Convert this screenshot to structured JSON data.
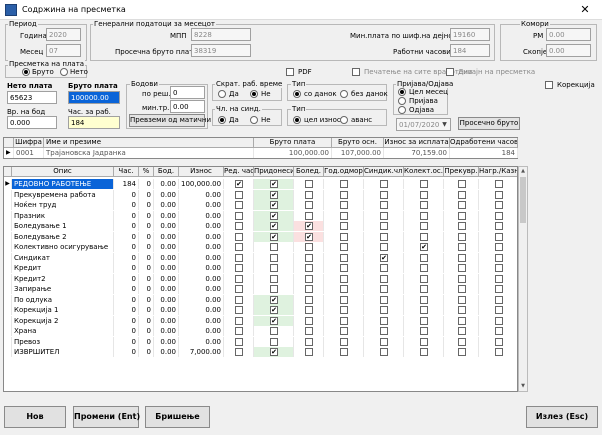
{
  "window": {
    "title": "Содржина на пресметка",
    "close": "✕"
  },
  "period": {
    "title": "Период",
    "year_label": "Година",
    "year": "2020",
    "month_label": "Месец",
    "month": "07"
  },
  "general": {
    "title": "Генерални податоци за месецот",
    "mpp_label": "МПП",
    "mpp": "8228",
    "avg_label": "Просечна бруто плата",
    "avg": "38319",
    "minpay_label": "Мин.плата по шиф.на дејност",
    "minpay": "19160",
    "hours_label": "Работни часови",
    "hours": "184"
  },
  "komori": {
    "title": "Комори",
    "rm_label": "РМ",
    "rm": "0.00",
    "skopje_label": "Скопје",
    "skopje": "0.00"
  },
  "calc": {
    "title": "Пресметка на плата",
    "opt1": "Бруто",
    "opt2": "Нето"
  },
  "pdf_label": "PDF",
  "print_all_label": "Печатење на сите вработени",
  "design_label": "Дизајн на пресметка",
  "correction_label": "Корекција",
  "net": {
    "label": "Нето плата",
    "value": "65623"
  },
  "gross": {
    "label": "Бруто плата",
    "value": "100000.00"
  },
  "exp": {
    "label": "Вр. на бод",
    "value": "0.000"
  },
  "hrs": {
    "label": "Час. за раб.",
    "value": "184"
  },
  "points": {
    "title": "Бодови",
    "per_label": "по реш.",
    "per": "0",
    "min_label": "мин.тр.",
    "min": "0.00",
    "btn": "Превземи од матични"
  },
  "short": {
    "title": "Скрат. раб. време",
    "opt1": "Да",
    "opt2": "Не"
  },
  "union": {
    "title": "Чл. на синд.",
    "opt1": "Да",
    "opt2": "Не"
  },
  "type1": {
    "title": "Тип",
    "opt1": "со данок",
    "opt2": "без данок"
  },
  "type2": {
    "title": "Тип",
    "opt1": "цел износ",
    "opt2": "аванс"
  },
  "reg": {
    "title": "Пријава/Одјава",
    "opt1": "Цел месец",
    "opt2": "Пријава",
    "opt3": "Одјава",
    "date": "01/07/2020",
    "avg_btn": "Просечно бруто"
  },
  "emp_headers": [
    "Шифра",
    "Име и презиме",
    "Бруто плата",
    "Бруто осн.",
    "Износ за исплата",
    "Одработени часови"
  ],
  "employee": {
    "code": "0001",
    "name": "Трајановска Јадранка",
    "gross": "100,000.00",
    "base": "107,000.00",
    "pay": "70,159.00",
    "hours": "184"
  },
  "item_headers": [
    "Опис",
    "Час.",
    "%",
    "Бод.",
    "Износ",
    "Ред. час",
    "Придонеси",
    "Болед.",
    "Год.одмор",
    "Синдик.чл.",
    "Колект.ос.",
    "Прекувр.",
    "Нагр./Казна"
  ],
  "items": [
    {
      "name": "РЕДОВНО РАБОТЕЊЕ",
      "hours": "184",
      "pct": "0",
      "pts": "0.00",
      "amt": "100,000.00"
    },
    {
      "name": "Прекувремена работа",
      "hours": "0",
      "pct": "0",
      "pts": "0.00",
      "amt": "0.00"
    },
    {
      "name": "Ноќен труд",
      "hours": "0",
      "pct": "0",
      "pts": "0.00",
      "amt": "0.00"
    },
    {
      "name": "Празник",
      "hours": "0",
      "pct": "0",
      "pts": "0.00",
      "amt": "0.00"
    },
    {
      "name": "Боледување 1",
      "hours": "0",
      "pct": "0",
      "pts": "0.00",
      "amt": "0.00"
    },
    {
      "name": "Боледување 2",
      "hours": "0",
      "pct": "0",
      "pts": "0.00",
      "amt": "0.00"
    },
    {
      "name": "Колективно осигурување",
      "hours": "0",
      "pct": "0",
      "pts": "0.00",
      "amt": "0.00"
    },
    {
      "name": "Синдикат",
      "hours": "0",
      "pct": "0",
      "pts": "0.00",
      "amt": "0.00"
    },
    {
      "name": "Кредит",
      "hours": "0",
      "pct": "0",
      "pts": "0.00",
      "amt": "0.00"
    },
    {
      "name": "Кредит2",
      "hours": "0",
      "pct": "0",
      "pts": "0.00",
      "amt": "0.00"
    },
    {
      "name": "Запирање",
      "hours": "0",
      "pct": "0",
      "pts": "0.00",
      "amt": "0.00"
    },
    {
      "name": "По одлука",
      "hours": "0",
      "pct": "0",
      "pts": "0.00",
      "amt": "0.00"
    },
    {
      "name": "Корекција 1",
      "hours": "0",
      "pct": "0",
      "pts": "0.00",
      "amt": "0.00"
    },
    {
      "name": "Корекција 2",
      "hours": "0",
      "pct": "0",
      "pts": "0.00",
      "amt": "0.00"
    },
    {
      "name": "Храна",
      "hours": "0",
      "pct": "0",
      "pts": "0.00",
      "amt": "0.00"
    },
    {
      "name": "Превоз",
      "hours": "0",
      "pct": "0",
      "pts": "0.00",
      "amt": "0.00"
    },
    {
      "name": "ИЗВРШИТЕЛ",
      "hours": "0",
      "pct": "0",
      "pts": "0.00",
      "amt": "7,000.00"
    }
  ],
  "checks": [
    [
      1,
      1,
      0,
      0,
      0,
      0,
      0,
      0
    ],
    [
      0,
      1,
      0,
      0,
      0,
      0,
      0,
      0
    ],
    [
      0,
      1,
      0,
      0,
      0,
      0,
      0,
      0
    ],
    [
      0,
      1,
      0,
      0,
      0,
      0,
      0,
      0
    ],
    [
      0,
      1,
      1,
      0,
      0,
      0,
      0,
      0
    ],
    [
      0,
      1,
      1,
      0,
      0,
      0,
      0,
      0
    ],
    [
      0,
      0,
      0,
      0,
      0,
      1,
      0,
      0
    ],
    [
      0,
      0,
      0,
      0,
      1,
      0,
      0,
      0
    ],
    [
      0,
      0,
      0,
      0,
      0,
      0,
      0,
      0
    ],
    [
      0,
      0,
      0,
      0,
      0,
      0,
      0,
      0
    ],
    [
      0,
      0,
      0,
      0,
      0,
      0,
      0,
      0
    ],
    [
      0,
      1,
      0,
      0,
      0,
      0,
      0,
      0
    ],
    [
      0,
      1,
      0,
      0,
      0,
      0,
      0,
      0
    ],
    [
      0,
      1,
      0,
      0,
      0,
      0,
      0,
      0
    ],
    [
      0,
      0,
      0,
      0,
      0,
      0,
      0,
      0
    ],
    [
      0,
      0,
      0,
      0,
      0,
      0,
      0,
      0
    ],
    [
      0,
      1,
      0,
      0,
      0,
      0,
      0,
      0
    ]
  ],
  "buttons": {
    "new": "Нов",
    "edit": "Промени (Ent)",
    "delete": "Бришење",
    "exit": "Излез (Esc)"
  },
  "colors": {
    "selected": "#0a64d8",
    "green": "#dff2df",
    "pink": "#fbe0e0",
    "yellow": "#ffffd0"
  }
}
